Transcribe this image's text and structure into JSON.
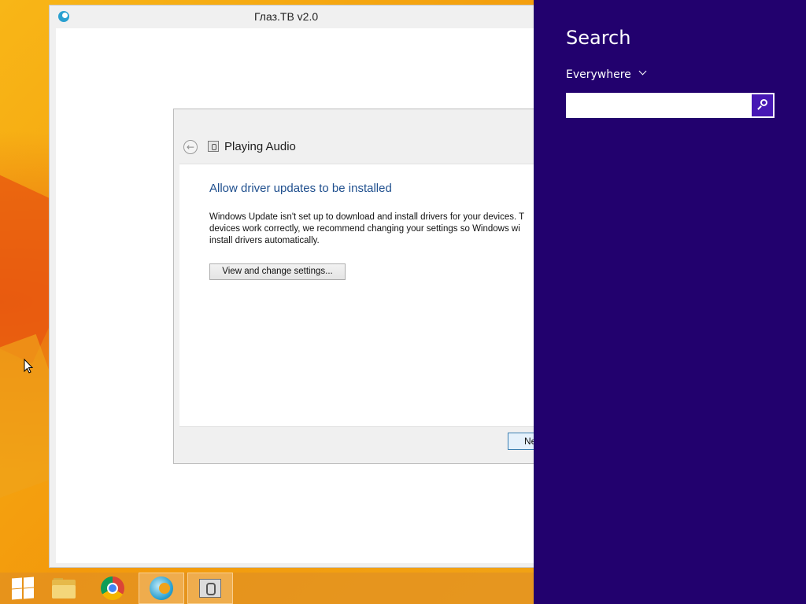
{
  "app_window": {
    "title": "Глаз.ТВ v2.0",
    "icon": "glaz-tv-icon"
  },
  "dialog": {
    "title": "Playing Audio",
    "heading": "Allow driver updates to be installed",
    "body": "Windows Update isn't set up to download and install drivers for your devices. T\ndevices work correctly, we recommend changing your settings so Windows wi\ninstall drivers automatically.",
    "settings_button": "View and change settings...",
    "next_button": "Ne"
  },
  "search_charm": {
    "title": "Search",
    "scope": "Everywhere",
    "input_value": "",
    "accent_color": "#22016e",
    "button_color": "#4617b4"
  },
  "taskbar": {
    "items": [
      {
        "name": "start",
        "icon": "windows-logo-icon"
      },
      {
        "name": "file-explorer",
        "icon": "folder-icon"
      },
      {
        "name": "chrome",
        "icon": "chrome-icon"
      },
      {
        "name": "glaz-tv",
        "icon": "glaz-tv-icon",
        "active": true
      },
      {
        "name": "playing-audio",
        "icon": "troubleshooter-icon",
        "active": true
      }
    ]
  }
}
